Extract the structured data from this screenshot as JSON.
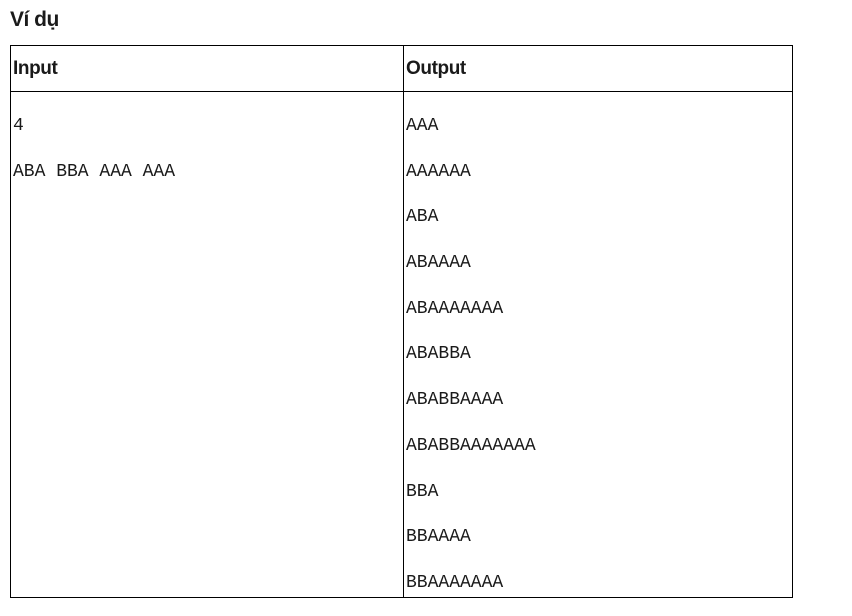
{
  "section_title": "Ví dụ",
  "table": {
    "input_header": "Input",
    "output_header": "Output",
    "input_lines": [
      "4",
      "ABA BBA AAA AAA"
    ],
    "output_lines": [
      "AAA",
      "AAAAAA",
      "ABA",
      "ABAAAA",
      "ABAAAAAAA",
      "ABABBA",
      "ABABBAAAA",
      "ABABBAAAAAAA",
      "BBA",
      "BBAAAA",
      "BBAAAAAAA"
    ]
  }
}
